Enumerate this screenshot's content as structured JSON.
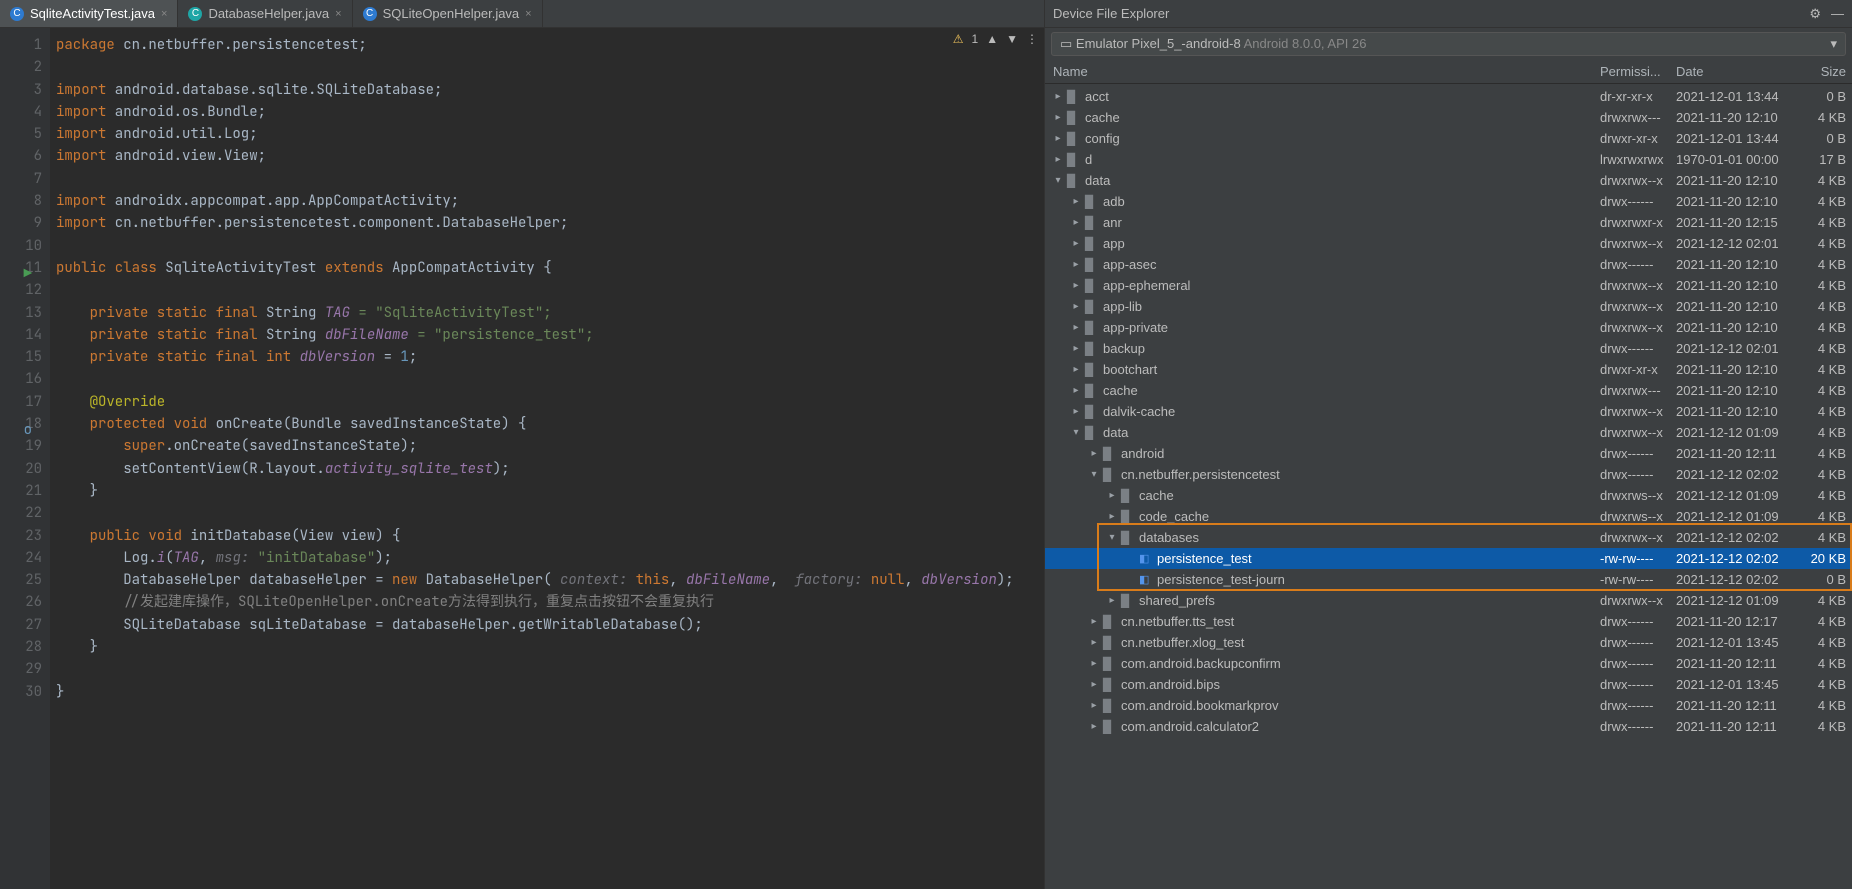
{
  "tabs": [
    {
      "label": "SqliteActivityTest.java",
      "icon": "c-blue",
      "active": true
    },
    {
      "label": "DatabaseHelper.java",
      "icon": "c-cyan",
      "active": false
    },
    {
      "label": "SQLiteOpenHelper.java",
      "icon": "c-blue",
      "active": false
    }
  ],
  "status": {
    "warnings": "1"
  },
  "code": {
    "package_kw": "package",
    "package_name": " cn.netbuffer.persistencetest;",
    "import_kw": "import",
    "imports": [
      " android.database.sqlite.SQLiteDatabase;",
      " android.os.Bundle;",
      " android.util.Log;",
      " android.view.View;",
      " androidx.appcompat.app.AppCompatActivity;",
      " cn.netbuffer.persistencetest.component.DatabaseHelper;"
    ],
    "class_decl_1": "public class",
    "class_name": " SqliteActivityTest ",
    "extends_kw": "extends",
    "super_class": " AppCompatActivity {",
    "field1_mods": "private static final ",
    "field1_type": "String ",
    "field1_name": "TAG",
    "field1_val": " = \"SqliteActivityTest\";",
    "field2_mods": "private static final ",
    "field2_type": "String ",
    "field2_name": "dbFileName",
    "field2_val": " = \"persistence_test\";",
    "field3_mods": "private static final int ",
    "field3_name": "dbVersion",
    "field3_val": " = ",
    "field3_num": "1",
    "override": "@Override",
    "oncreate_mods": "protected void ",
    "oncreate_name": "onCreate",
    "oncreate_params": "(Bundle savedInstanceState) {",
    "super_call": "super",
    "super_rest": ".onCreate(savedInstanceState);",
    "setcontent": "        setContentView(R.layout.",
    "setcontent_field": "activity_sqlite_test",
    "setcontent_end": ");",
    "close_brace": "}",
    "initdb_mods": "public void ",
    "initdb_name": "initDatabase",
    "initdb_params": "(View view) {",
    "log_call": "        Log.",
    "log_i": "i",
    "log_open": "(",
    "log_tag": "TAG",
    "log_sep": ", ",
    "log_param_hint": "msg: ",
    "log_msg": "\"initDatabase\"",
    "log_close": ");",
    "dh_line1": "        DatabaseHelper databaseHelper = ",
    "new_kw": "new",
    "dh_line2": " DatabaseHelper( ",
    "ctx_hint": "context: ",
    "this_kw": "this",
    "dh_sep1": ", ",
    "dh_dbfile": "dbFileName",
    "dh_sep2": ",  ",
    "factory_hint": "factory: ",
    "null_kw": "null",
    "dh_sep3": ", ",
    "dh_ver": "dbVersion",
    "dh_end": ");",
    "comment": "        //发起建库操作，SQLiteOpenHelper.onCreate方法得到执行，重复点击按钮不会重复执行",
    "sqldb_line": "        SQLiteDatabase sqLiteDatabase = databaseHelper.getWritableDatabase();"
  },
  "explorer": {
    "title": "Device File Explorer",
    "device_name": "Emulator Pixel_5_-android-8",
    "device_info": " Android 8.0.0, API 26",
    "cols": {
      "name": "Name",
      "perm": "Permissi...",
      "date": "Date",
      "size": "Size"
    }
  },
  "files": [
    {
      "d": 0,
      "e": "c",
      "t": "folder",
      "n": "acct",
      "p": "dr-xr-xr-x",
      "dt": "2021-12-01 13:44",
      "s": "0 B"
    },
    {
      "d": 0,
      "e": "c",
      "t": "folder",
      "n": "cache",
      "p": "drwxrwx---",
      "dt": "2021-11-20 12:10",
      "s": "4 KB"
    },
    {
      "d": 0,
      "e": "c",
      "t": "folder",
      "n": "config",
      "p": "drwxr-xr-x",
      "dt": "2021-12-01 13:44",
      "s": "0 B"
    },
    {
      "d": 0,
      "e": "c",
      "t": "folder",
      "n": "d",
      "p": "lrwxrwxrwx",
      "dt": "1970-01-01 00:00",
      "s": "17 B"
    },
    {
      "d": 0,
      "e": "o",
      "t": "folder",
      "n": "data",
      "p": "drwxrwx--x",
      "dt": "2021-11-20 12:10",
      "s": "4 KB"
    },
    {
      "d": 1,
      "e": "c",
      "t": "folder",
      "n": "adb",
      "p": "drwx------",
      "dt": "2021-11-20 12:10",
      "s": "4 KB"
    },
    {
      "d": 1,
      "e": "c",
      "t": "folder",
      "n": "anr",
      "p": "drwxrwxr-x",
      "dt": "2021-11-20 12:15",
      "s": "4 KB"
    },
    {
      "d": 1,
      "e": "c",
      "t": "folder",
      "n": "app",
      "p": "drwxrwx--x",
      "dt": "2021-12-12 02:01",
      "s": "4 KB"
    },
    {
      "d": 1,
      "e": "c",
      "t": "folder",
      "n": "app-asec",
      "p": "drwx------",
      "dt": "2021-11-20 12:10",
      "s": "4 KB"
    },
    {
      "d": 1,
      "e": "c",
      "t": "folder",
      "n": "app-ephemeral",
      "p": "drwxrwx--x",
      "dt": "2021-11-20 12:10",
      "s": "4 KB"
    },
    {
      "d": 1,
      "e": "c",
      "t": "folder",
      "n": "app-lib",
      "p": "drwxrwx--x",
      "dt": "2021-11-20 12:10",
      "s": "4 KB"
    },
    {
      "d": 1,
      "e": "c",
      "t": "folder",
      "n": "app-private",
      "p": "drwxrwx--x",
      "dt": "2021-11-20 12:10",
      "s": "4 KB"
    },
    {
      "d": 1,
      "e": "c",
      "t": "folder",
      "n": "backup",
      "p": "drwx------",
      "dt": "2021-12-12 02:01",
      "s": "4 KB"
    },
    {
      "d": 1,
      "e": "c",
      "t": "folder",
      "n": "bootchart",
      "p": "drwxr-xr-x",
      "dt": "2021-11-20 12:10",
      "s": "4 KB"
    },
    {
      "d": 1,
      "e": "c",
      "t": "folder",
      "n": "cache",
      "p": "drwxrwx---",
      "dt": "2021-11-20 12:10",
      "s": "4 KB"
    },
    {
      "d": 1,
      "e": "c",
      "t": "folder",
      "n": "dalvik-cache",
      "p": "drwxrwx--x",
      "dt": "2021-11-20 12:10",
      "s": "4 KB"
    },
    {
      "d": 1,
      "e": "o",
      "t": "folder",
      "n": "data",
      "p": "drwxrwx--x",
      "dt": "2021-12-12 01:09",
      "s": "4 KB"
    },
    {
      "d": 2,
      "e": "c",
      "t": "folder",
      "n": "android",
      "p": "drwx------",
      "dt": "2021-11-20 12:11",
      "s": "4 KB"
    },
    {
      "d": 2,
      "e": "o",
      "t": "folder",
      "n": "cn.netbuffer.persistencetest",
      "p": "drwx------",
      "dt": "2021-12-12 02:02",
      "s": "4 KB"
    },
    {
      "d": 3,
      "e": "c",
      "t": "folder",
      "n": "cache",
      "p": "drwxrws--x",
      "dt": "2021-12-12 01:09",
      "s": "4 KB"
    },
    {
      "d": 3,
      "e": "c",
      "t": "folder",
      "n": "code_cache",
      "p": "drwxrws--x",
      "dt": "2021-12-12 01:09",
      "s": "4 KB"
    },
    {
      "d": 3,
      "e": "o",
      "t": "folder",
      "n": "databases",
      "p": "drwxrwx--x",
      "dt": "2021-12-12 02:02",
      "s": "4 KB"
    },
    {
      "d": 4,
      "e": "",
      "t": "file",
      "n": "persistence_test",
      "p": "-rw-rw----",
      "dt": "2021-12-12 02:02",
      "s": "20 KB",
      "sel": true
    },
    {
      "d": 4,
      "e": "",
      "t": "file",
      "n": "persistence_test-journ",
      "p": "-rw-rw----",
      "dt": "2021-12-12 02:02",
      "s": "0 B"
    },
    {
      "d": 3,
      "e": "c",
      "t": "folder",
      "n": "shared_prefs",
      "p": "drwxrwx--x",
      "dt": "2021-12-12 01:09",
      "s": "4 KB"
    },
    {
      "d": 2,
      "e": "c",
      "t": "folder",
      "n": "cn.netbuffer.tts_test",
      "p": "drwx------",
      "dt": "2021-11-20 12:17",
      "s": "4 KB"
    },
    {
      "d": 2,
      "e": "c",
      "t": "folder",
      "n": "cn.netbuffer.xlog_test",
      "p": "drwx------",
      "dt": "2021-12-01 13:45",
      "s": "4 KB"
    },
    {
      "d": 2,
      "e": "c",
      "t": "folder",
      "n": "com.android.backupconfirm",
      "p": "drwx------",
      "dt": "2021-11-20 12:11",
      "s": "4 KB"
    },
    {
      "d": 2,
      "e": "c",
      "t": "folder",
      "n": "com.android.bips",
      "p": "drwx------",
      "dt": "2021-12-01 13:45",
      "s": "4 KB"
    },
    {
      "d": 2,
      "e": "c",
      "t": "folder",
      "n": "com.android.bookmarkprov",
      "p": "drwx------",
      "dt": "2021-11-20 12:11",
      "s": "4 KB"
    },
    {
      "d": 2,
      "e": "c",
      "t": "folder",
      "n": "com.android.calculator2",
      "p": "drwx------",
      "dt": "2021-11-20 12:11",
      "s": "4 KB"
    }
  ]
}
